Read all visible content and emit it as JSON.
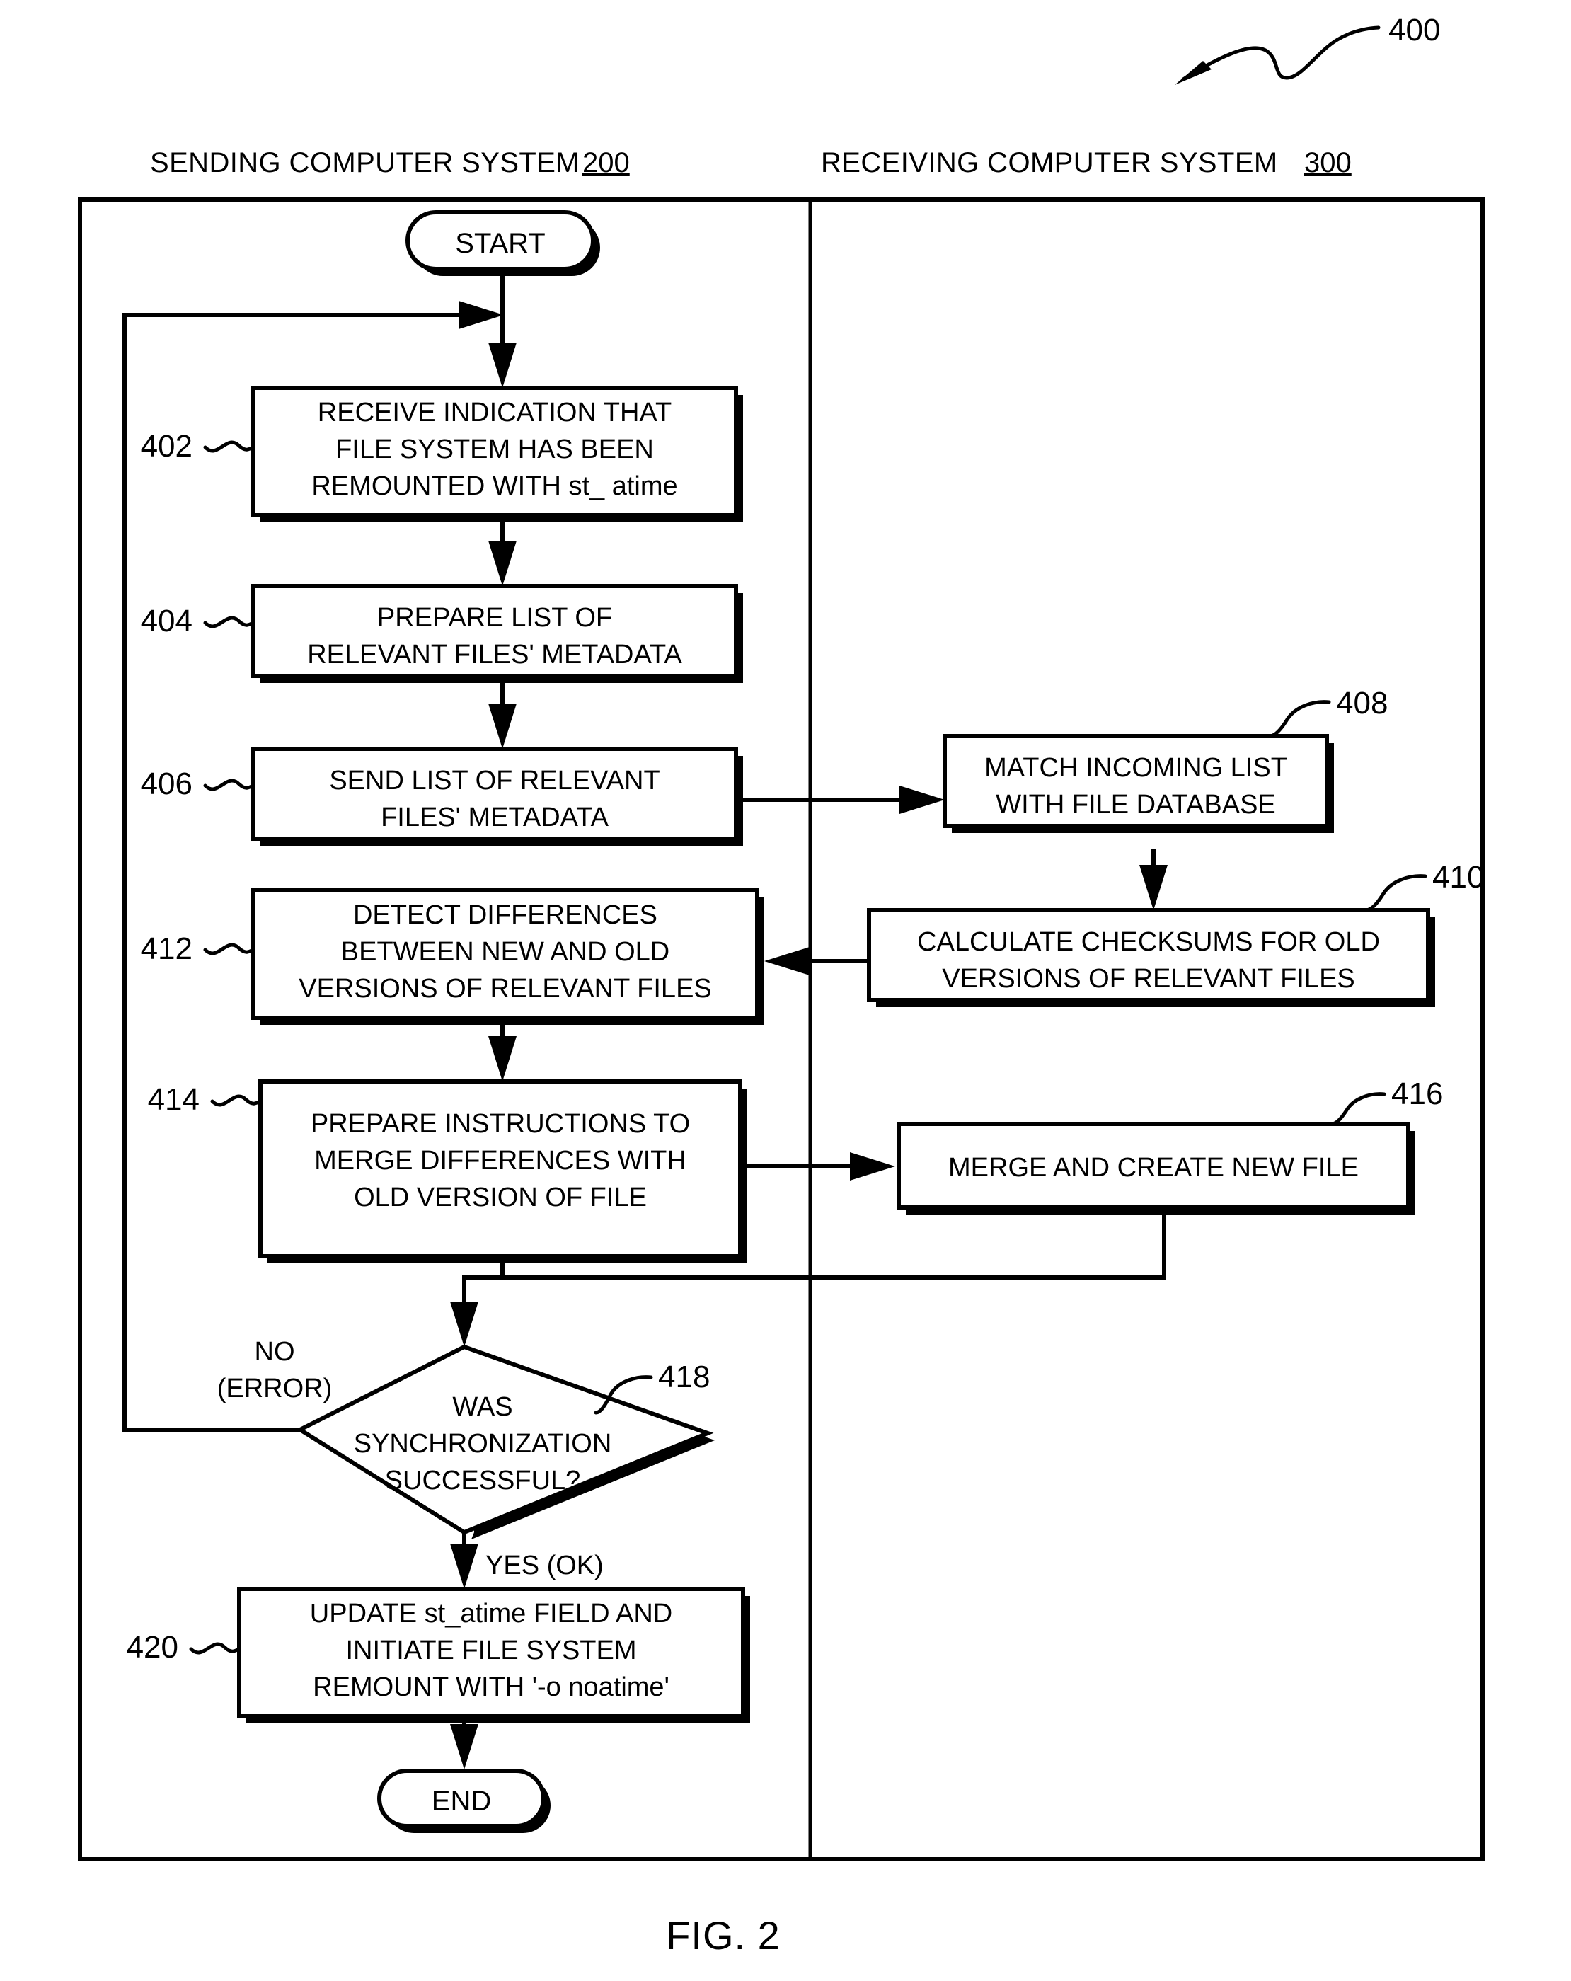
{
  "figure": {
    "caption": "FIG. 2",
    "reference_number": "400"
  },
  "columns": [
    {
      "title": "SENDING COMPUTER SYSTEM",
      "number": "200"
    },
    {
      "title": "RECEIVING COMPUTER SYSTEM",
      "number": "300"
    }
  ],
  "terminals": {
    "start": "START",
    "end": "END"
  },
  "nodes": [
    {
      "ref": "402",
      "column": "sending",
      "shape": "process",
      "lines": [
        "RECEIVE INDICATION THAT",
        "FILE SYSTEM HAS BEEN",
        "REMOUNTED WITH st_ atime"
      ]
    },
    {
      "ref": "404",
      "column": "sending",
      "shape": "process",
      "lines": [
        "PREPARE LIST OF",
        "RELEVANT FILES' METADATA"
      ]
    },
    {
      "ref": "406",
      "column": "sending",
      "shape": "process",
      "lines": [
        "SEND LIST OF RELEVANT",
        "FILES' METADATA"
      ]
    },
    {
      "ref": "408",
      "column": "receiving",
      "shape": "process",
      "lines": [
        "MATCH INCOMING LIST",
        "WITH FILE DATABASE"
      ]
    },
    {
      "ref": "410",
      "column": "receiving",
      "shape": "process",
      "lines": [
        "CALCULATE CHECKSUMS FOR OLD",
        "VERSIONS OF RELEVANT FILES"
      ]
    },
    {
      "ref": "412",
      "column": "sending",
      "shape": "process",
      "lines": [
        "DETECT DIFFERENCES",
        "BETWEEN NEW AND OLD",
        "VERSIONS OF RELEVANT FILES"
      ]
    },
    {
      "ref": "414",
      "column": "sending",
      "shape": "process",
      "lines": [
        "PREPARE INSTRUCTIONS TO",
        "MERGE DIFFERENCES WITH",
        "OLD VERSION OF FILE"
      ]
    },
    {
      "ref": "416",
      "column": "receiving",
      "shape": "process",
      "lines": [
        "MERGE AND CREATE NEW FILE"
      ]
    },
    {
      "ref": "418",
      "column": "sending",
      "shape": "decision",
      "lines": [
        "WAS",
        "SYNCHRONIZATION",
        "SUCCESSFUL?"
      ]
    },
    {
      "ref": "420",
      "column": "sending",
      "shape": "process",
      "lines": [
        "UPDATE st_atime FIELD AND",
        "INITIATE FILE SYSTEM",
        "REMOUNT WITH '-o noatime'"
      ]
    }
  ],
  "edge_labels": {
    "no_line1": "NO",
    "no_line2": "(ERROR)",
    "yes": "YES (OK)"
  },
  "colors": {
    "ink": "#000000",
    "paper": "#ffffff"
  }
}
